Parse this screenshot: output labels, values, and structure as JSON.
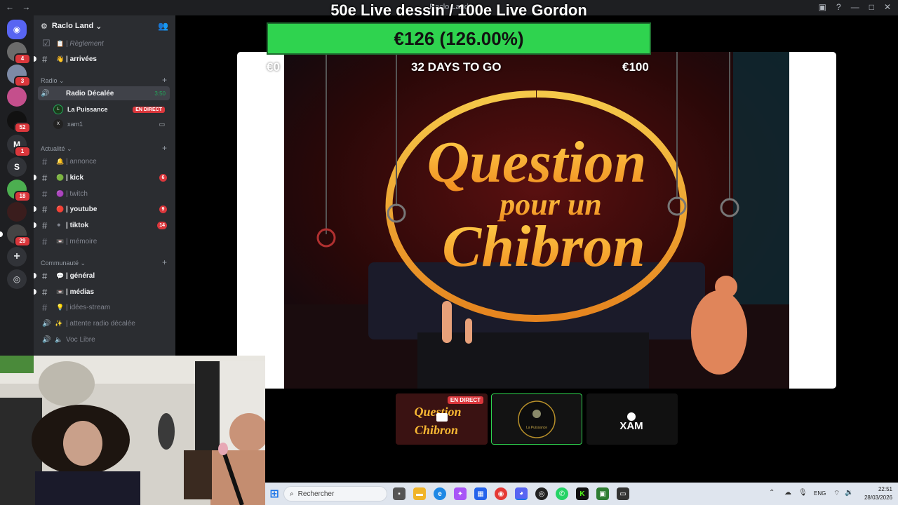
{
  "window": {
    "title": "Raclo Land",
    "nav": "← →"
  },
  "overlay": {
    "title": "50e Live dessin / 100e Live Gordon"
  },
  "goal": {
    "amount_text": "€126 (126.00%)",
    "progress": 1.26,
    "start": "€0",
    "days": "32 DAYS TO GO",
    "target": "€100"
  },
  "server": {
    "name": "Raclo Land",
    "chevron": "⌄"
  },
  "rail": {
    "badges": [
      "4",
      "3",
      "",
      "52",
      "1",
      "",
      "18",
      "",
      "29"
    ],
    "letters": {
      "m": "M",
      "s": "S"
    }
  },
  "channels": {
    "reglement": {
      "icon": "📋",
      "label": "| Règlement"
    },
    "arrivees": {
      "icon": "👋",
      "label": "| arrivées"
    },
    "annonce": {
      "icon": "🔔",
      "label": "| annonce"
    },
    "kick": {
      "icon": "🟢",
      "label": "| kick",
      "badge": "6"
    },
    "twitch": {
      "icon": "🟣",
      "label": "| twitch"
    },
    "youtube": {
      "icon": "🔴",
      "label": "| youtube",
      "badge": "9"
    },
    "tiktok": {
      "icon": "⚫",
      "label": "| tiktok",
      "badge": "14"
    },
    "memoire": {
      "icon": "📼",
      "label": "| mémoire"
    },
    "general": {
      "icon": "💬",
      "label": "| général"
    },
    "medias": {
      "icon": "📼",
      "label": "| médias"
    },
    "idees": {
      "icon": "💡",
      "label": "| idées-stream"
    },
    "attente": {
      "icon": "✨",
      "label": "| attente radio décalée"
    },
    "voclibre": {
      "label": "Voc Libre"
    }
  },
  "categories": {
    "radio": "Radio ⌄",
    "actualite": "Actualité ⌄",
    "communaute": "Communauté ⌄"
  },
  "voice": {
    "channel": "Radio Décalée",
    "timer": "3:50",
    "users": [
      {
        "name": "La Puissance",
        "badge": "EN DIRECT"
      },
      {
        "name": "xam1"
      }
    ]
  },
  "stream": {
    "line1": "Question",
    "line2": "pour un",
    "line3": "Chibron"
  },
  "thumbs": {
    "live": "EN DIRECT",
    "q": "Question",
    "c": "Chibron",
    "lp": "La Puissance",
    "xam": "XAM"
  },
  "taskbar": {
    "search_placeholder": "Rechercher",
    "lang": "ENG",
    "time": "22:51",
    "date": "28/03/2026"
  },
  "colors": {
    "accent_green": "#2fd34f",
    "discord_bg": "#2b2d31",
    "rail_bg": "#1e1f22",
    "mention_red": "#da373c"
  }
}
